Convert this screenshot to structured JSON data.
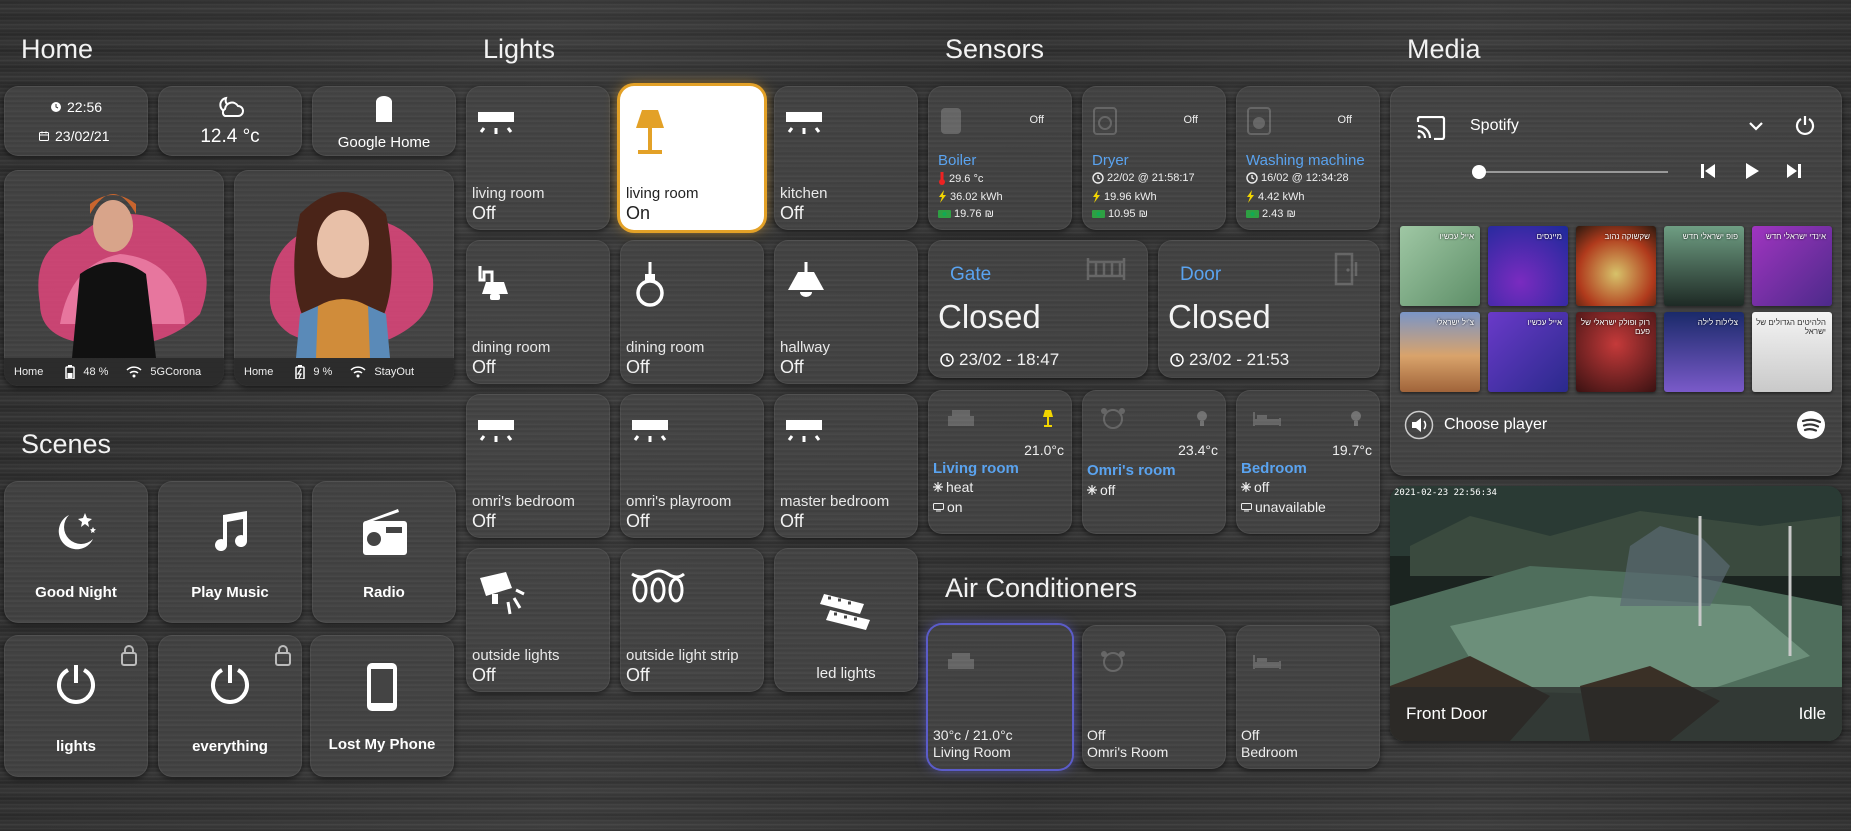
{
  "sections": {
    "home": "Home",
    "lights": "Lights",
    "sensors": "Sensors",
    "media": "Media",
    "scenes": "Scenes",
    "ac": "Air Conditioners"
  },
  "home": {
    "time": "22:56",
    "date": "23/02/21",
    "weather_temp": "12.4 °c",
    "google_home": "Google Home",
    "persons": [
      {
        "location": "Home",
        "battery": "48 %",
        "wifi": "5GCorona"
      },
      {
        "location": "Home",
        "battery": "9 %",
        "wifi": "StayOut"
      }
    ]
  },
  "scenes": [
    {
      "label": "Good Night",
      "icon": "moon-stars-icon"
    },
    {
      "label": "Play Music",
      "icon": "music-note-icon"
    },
    {
      "label": "Radio",
      "icon": "radio-icon"
    },
    {
      "label": "lights",
      "icon": "power-icon"
    },
    {
      "label": "everything",
      "icon": "power-icon"
    },
    {
      "label": "Lost My Phone",
      "icon": "cellphone-icon"
    }
  ],
  "lights": [
    {
      "name": "living room",
      "state": "Off",
      "icon": "ceiling-light-icon"
    },
    {
      "name": "living room",
      "state": "On",
      "icon": "floor-lamp-icon"
    },
    {
      "name": "kitchen",
      "state": "Off",
      "icon": "ceiling-light-icon"
    },
    {
      "name": "dining room",
      "state": "Off",
      "icon": "wall-lamp-icon"
    },
    {
      "name": "dining room",
      "state": "Off",
      "icon": "pendant-bulb-icon"
    },
    {
      "name": "hallway",
      "state": "Off",
      "icon": "ceiling-lamp-icon"
    },
    {
      "name": "omri's bedroom",
      "state": "Off",
      "icon": "ceiling-light-icon"
    },
    {
      "name": "omri's playroom",
      "state": "Off",
      "icon": "ceiling-light-icon"
    },
    {
      "name": "master bedroom",
      "state": "Off",
      "icon": "ceiling-light-icon"
    },
    {
      "name": "outside lights",
      "state": "Off",
      "icon": "spotlight-icon"
    },
    {
      "name": "outside light strip",
      "state": "Off",
      "icon": "string-lights-icon"
    },
    {
      "name": "led lights",
      "state": "",
      "icon": "led-strip-icon"
    }
  ],
  "sensors": {
    "appliances": [
      {
        "name": "Boiler",
        "off": "Off",
        "line1": "29.6 °c",
        "line2": "36.02 kWh",
        "line3": "19.76 ₪"
      },
      {
        "name": "Dryer",
        "off": "Off",
        "line1": "22/02 @ 21:58:17",
        "line2": "19.96 kWh",
        "line3": "10.95 ₪"
      },
      {
        "name": "Washing machine",
        "off": "Off",
        "line1": "16/02 @ 12:34:28",
        "line2": "4.42 kWh",
        "line3": "2.43 ₪"
      }
    ],
    "gate": {
      "title": "Gate",
      "state": "Closed",
      "time": "23/02 - 18:47"
    },
    "door": {
      "title": "Door",
      "state": "Closed",
      "time": "23/02 - 21:53"
    },
    "climate": [
      {
        "name": "Living room",
        "temp": "21.0°c",
        "mode": "heat",
        "extra": "on"
      },
      {
        "name": "Omri's room",
        "temp": "23.4°c",
        "mode": "off",
        "extra": ""
      },
      {
        "name": "Bedroom",
        "temp": "19.7°c",
        "mode": "off",
        "extra": "unavailable"
      }
    ]
  },
  "ac": [
    {
      "line1": "30°c / 21.0°c",
      "line2": "Living Room"
    },
    {
      "line1": "Off",
      "line2": "Omri's Room"
    },
    {
      "line1": "Off",
      "line2": "Bedroom"
    }
  ],
  "media": {
    "source": "Spotify",
    "choose_player": "Choose player",
    "playlists": [
      {
        "label": "אייל עכשיו",
        "color1": "#9fc7a4",
        "color2": "#5e8f68"
      },
      {
        "label": "מיינסים",
        "color1": "#1c2a9a",
        "color2": "#7a2bc0"
      },
      {
        "label": "שקשוקה נהוב",
        "color1": "#d7c26a",
        "color2": "#b03a1c"
      },
      {
        "label": "פופ ישראלי חדש",
        "color1": "#6f9e83",
        "color2": "#1e2a25"
      },
      {
        "label": "אינדי ישראלי חדש",
        "color1": "#4c2a8a",
        "color2": "#a035c0"
      },
      {
        "label": "צ'יל ישראלי",
        "color1": "#d9a36b",
        "color2": "#7a95c7"
      },
      {
        "label": "אייל עכשיו",
        "color1": "#2a2a8c",
        "color2": "#6a3ac9"
      },
      {
        "label": "רוק ופולק ישראלי של פעם",
        "color1": "#c53a3a",
        "color2": "#3a1212"
      },
      {
        "label": "צלילות לילה",
        "color1": "#1a2a6a",
        "color2": "#7a5ac9"
      },
      {
        "label": "הלהיטים הגדולים של ישראל",
        "color1": "#f4f4f4",
        "color2": "#c9c9c9"
      }
    ]
  },
  "camera": {
    "name": "Front Door",
    "state": "Idle",
    "timestamp": "2021-02-23 22:56:34"
  }
}
